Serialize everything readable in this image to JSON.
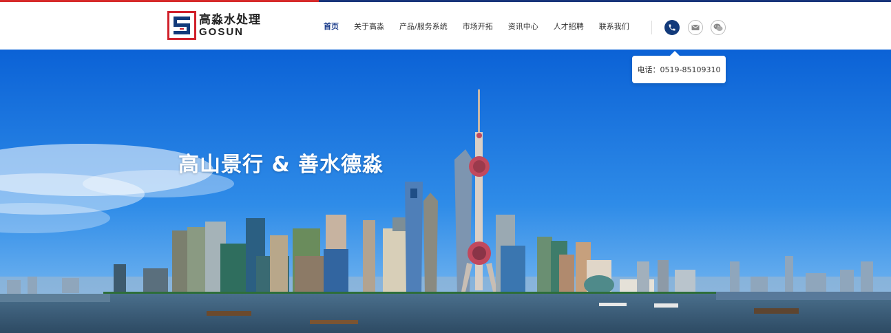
{
  "brand": {
    "name_cn": "高淼水处理",
    "name_en": "GOSUN",
    "accent_red": "#d0202a",
    "accent_blue": "#123a7a"
  },
  "nav": {
    "items": [
      {
        "label": "首页",
        "active": true
      },
      {
        "label": "关于高淼",
        "active": false
      },
      {
        "label": "产品/服务系统",
        "active": false
      },
      {
        "label": "市场开拓",
        "active": false
      },
      {
        "label": "资讯中心",
        "active": false
      },
      {
        "label": "人才招聘",
        "active": false
      },
      {
        "label": "联系我们",
        "active": false
      }
    ]
  },
  "contact_icons": [
    "phone-icon",
    "mail-icon",
    "wechat-icon"
  ],
  "tooltip": {
    "text": "电话：0519-85109310"
  },
  "hero": {
    "slogan": "高山景行 & 善水德淼"
  }
}
